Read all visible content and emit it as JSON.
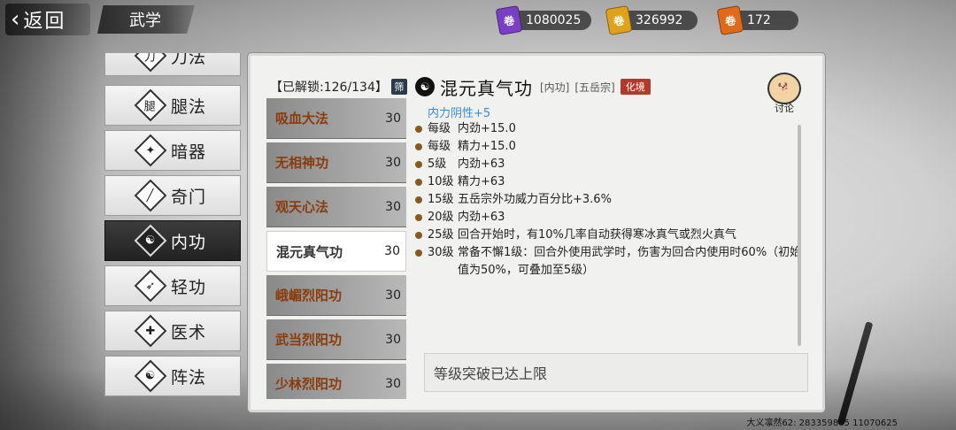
{
  "topbar": {
    "back_label": "返回",
    "page_title": "武学",
    "currencies": [
      {
        "icon": "purple-scroll-icon",
        "color": "#7a3fc4",
        "value": "1080025"
      },
      {
        "icon": "gold-scroll-icon",
        "color": "#e0a21a",
        "value": "326992"
      },
      {
        "icon": "flame-scroll-icon",
        "color": "#e06a1a",
        "value": "172"
      }
    ]
  },
  "categories": [
    {
      "label": "刀法",
      "icon": "blade-icon",
      "active": false
    },
    {
      "label": "腿法",
      "icon": "kick-icon",
      "active": false
    },
    {
      "label": "暗器",
      "icon": "shuriken-icon",
      "active": false
    },
    {
      "label": "奇门",
      "icon": "odd-weapon-icon",
      "active": false
    },
    {
      "label": "内功",
      "icon": "meditation-icon",
      "active": true
    },
    {
      "label": "轻功",
      "icon": "leap-icon",
      "active": false
    },
    {
      "label": "医术",
      "icon": "medicine-icon",
      "active": false
    },
    {
      "label": "阵法",
      "icon": "yin-yang-icon",
      "active": false
    }
  ],
  "unlock": {
    "text": "【已解锁:126/134】",
    "filter_label": "筛"
  },
  "skills": [
    {
      "name": "吸血大法",
      "level": "30",
      "active": false
    },
    {
      "name": "无相神功",
      "level": "30",
      "active": false
    },
    {
      "name": "观天心法",
      "level": "30",
      "active": false
    },
    {
      "name": "混元真气功",
      "level": "30",
      "active": true
    },
    {
      "name": "峨嵋烈阳功",
      "level": "30",
      "active": false
    },
    {
      "name": "武当烈阳功",
      "level": "30",
      "active": false
    },
    {
      "name": "少林烈阳功",
      "level": "30",
      "active": false
    }
  ],
  "detail": {
    "title": "混元真气功",
    "type_tag": "[内功]",
    "school_tag": "[五岳宗]",
    "realm": "化境",
    "primary": "内力阴性+5",
    "lines": [
      {
        "lvl": "每级",
        "text": "内劲+15.0"
      },
      {
        "lvl": "每级",
        "text": "精力+15.0"
      },
      {
        "lvl": "5级",
        "text": "内劲+63"
      },
      {
        "lvl": "10级",
        "text": "精力+63"
      },
      {
        "lvl": "15级",
        "text": "五岳宗外功威力百分比+3.6%"
      },
      {
        "lvl": "20级",
        "text": "内劲+63"
      },
      {
        "lvl": "25级",
        "text": "回合开始时，有10%几率自动获得寒冰真气或烈火真气"
      },
      {
        "lvl": "30级",
        "text": "常备不懈1级：回合外使用武学时，伤害为回合内使用时60%（初始值为50%，可叠加至5级）"
      }
    ],
    "limit_text": "等级突破已达上限"
  },
  "discuss_label": "讨论",
  "footer_id": "大义凛然62: 283359885 11070625"
}
